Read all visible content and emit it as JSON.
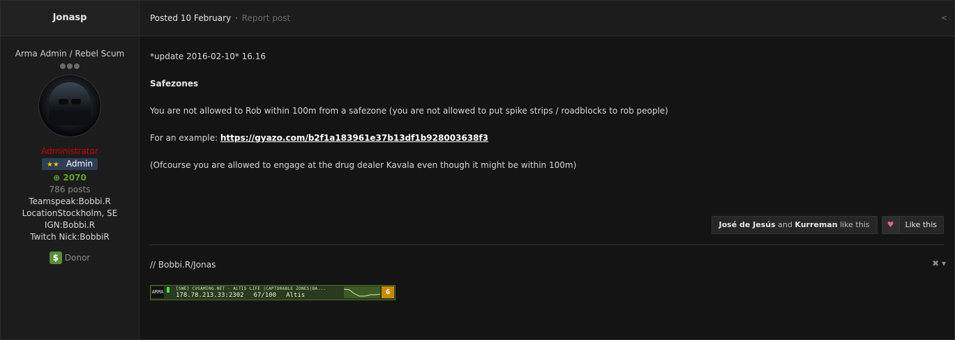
{
  "author": {
    "name": "Jonasp",
    "title": "Arma Admin / Rebel Scum",
    "group": "Administrator",
    "badge": "Admin",
    "reputation": "2070",
    "posts": "786 posts",
    "fields": [
      "Teamspeak:Bobbi.R",
      "LocationStockholm, SE",
      "IGN:Bobbi.R",
      "Twitch Nick:BobbiR"
    ],
    "donor": "Donor"
  },
  "meta": {
    "posted": "Posted 10 February",
    "report": "Report post"
  },
  "content": {
    "update": "*update 2016-02-10* 16.16",
    "heading": "Safezones",
    "rule": "You are not allowed to Rob within 100m from a safezone (you are not allowed to put spike strips / roadblocks to rob people)",
    "example_prefix": "For an example: ",
    "example_link": "https://gyazo.com/b2f1a183961e37b13df1b928003638f3",
    "note": "(Ofcourse you are allowed to engage at the drug dealer Kavala even though it might be within 100m)"
  },
  "likes": {
    "user1": "José de Jesús",
    "and": "and",
    "user2": "Kurreman",
    "suffix": "like this",
    "button": "Like this"
  },
  "signature": {
    "text": "// Bobbi.R/Jonas",
    "banner_title": "[SWE] CVGAMING.NET - ALTIS LIFE |CAPTURABLE ZONES|BA...",
    "banner_ip": "178.78.213.33:2302",
    "banner_players": "67/100",
    "banner_map": "Altis"
  }
}
